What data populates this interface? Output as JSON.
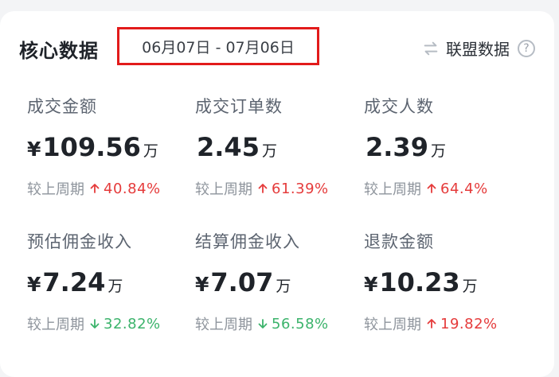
{
  "header": {
    "title": "核心数据",
    "date_range": "06月07日 - 07月06日",
    "alliance_label": "联盟数据",
    "help_symbol": "?"
  },
  "compare_label": "较上周期",
  "metrics": [
    {
      "label": "成交金额",
      "currency": "¥",
      "value": "109.56",
      "unit": "万",
      "change": "40.84%",
      "direction": "up"
    },
    {
      "label": "成交订单数",
      "currency": "",
      "value": "2.45",
      "unit": "万",
      "change": "61.39%",
      "direction": "up"
    },
    {
      "label": "成交人数",
      "currency": "",
      "value": "2.39",
      "unit": "万",
      "change": "64.4%",
      "direction": "up"
    },
    {
      "label": "预估佣金收入",
      "currency": "¥",
      "value": "7.24",
      "unit": "万",
      "change": "32.82%",
      "direction": "down"
    },
    {
      "label": "结算佣金收入",
      "currency": "¥",
      "value": "7.07",
      "unit": "万",
      "change": "56.58%",
      "direction": "down"
    },
    {
      "label": "退款金额",
      "currency": "¥",
      "value": "10.23",
      "unit": "万",
      "change": "19.82%",
      "direction": "up"
    }
  ],
  "colors": {
    "up": "#e53b3b",
    "down": "#3bb36b",
    "highlight_box": "#e21b1b"
  }
}
